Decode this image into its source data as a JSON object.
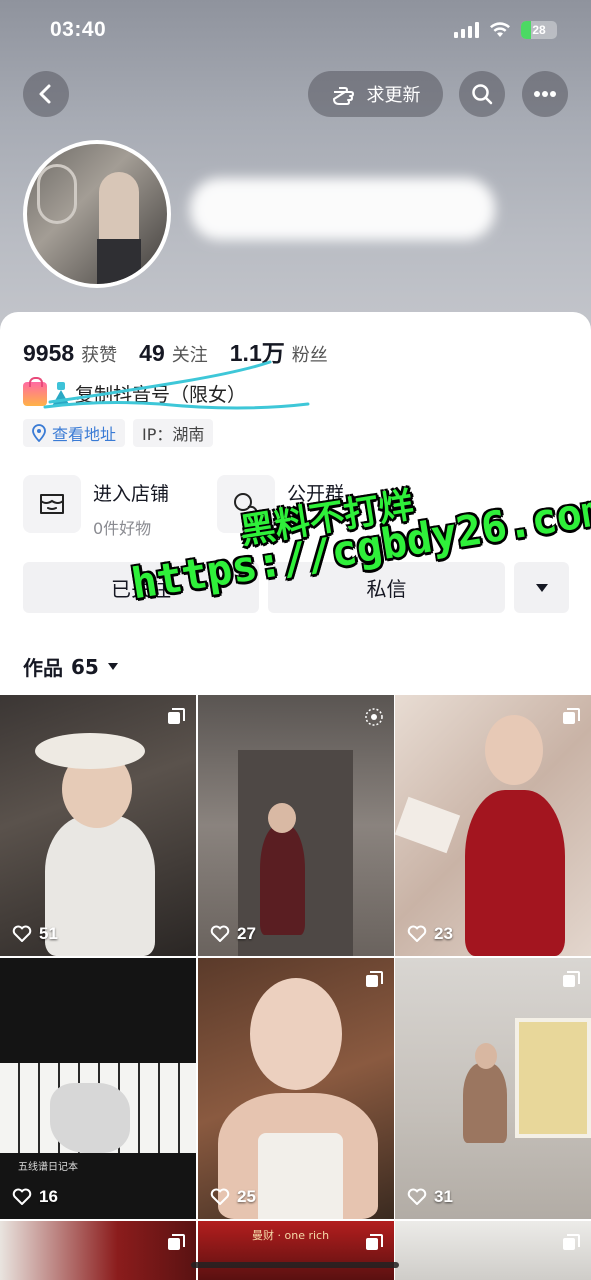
{
  "status_bar": {
    "time": "03:40",
    "battery": "28",
    "battery_level": 0.28
  },
  "header": {
    "back_icon": "chevron-left-icon",
    "update_button_label": "求更新",
    "update_icon": "hand-point-icon",
    "search_icon": "search-icon",
    "more_icon": "more-horizontal-icon"
  },
  "profile": {
    "stats": [
      {
        "value": "9958",
        "label": "获赞"
      },
      {
        "value": "49",
        "label": "关注"
      },
      {
        "value": "1.1万",
        "label": "粉丝"
      }
    ],
    "bio": "复制抖音号（限女）",
    "location_tag": "查看地址",
    "ip_tag": "IP：湖南"
  },
  "features": {
    "shop_title": "进入店铺",
    "shop_sub": "0件好物",
    "group_title": "公开群"
  },
  "actions": {
    "followed_label": "已关注",
    "message_label": "私信"
  },
  "watermark": {
    "line1": "黑料不打烊",
    "line2": "https://cgbdy26.com"
  },
  "works": {
    "label": "作品",
    "count": "65"
  },
  "videos": [
    {
      "likes": "51"
    },
    {
      "likes": "27"
    },
    {
      "likes": "23"
    },
    {
      "likes": "16",
      "caption": "五线谱日记本"
    },
    {
      "likes": "25"
    },
    {
      "likes": "31"
    },
    {
      "likes": ""
    },
    {
      "likes": "",
      "caption": "曼财 · one rich"
    },
    {
      "likes": ""
    }
  ],
  "colors": {
    "accent_link": "#3a7bd5",
    "watermark_green": "#2ff03a"
  }
}
